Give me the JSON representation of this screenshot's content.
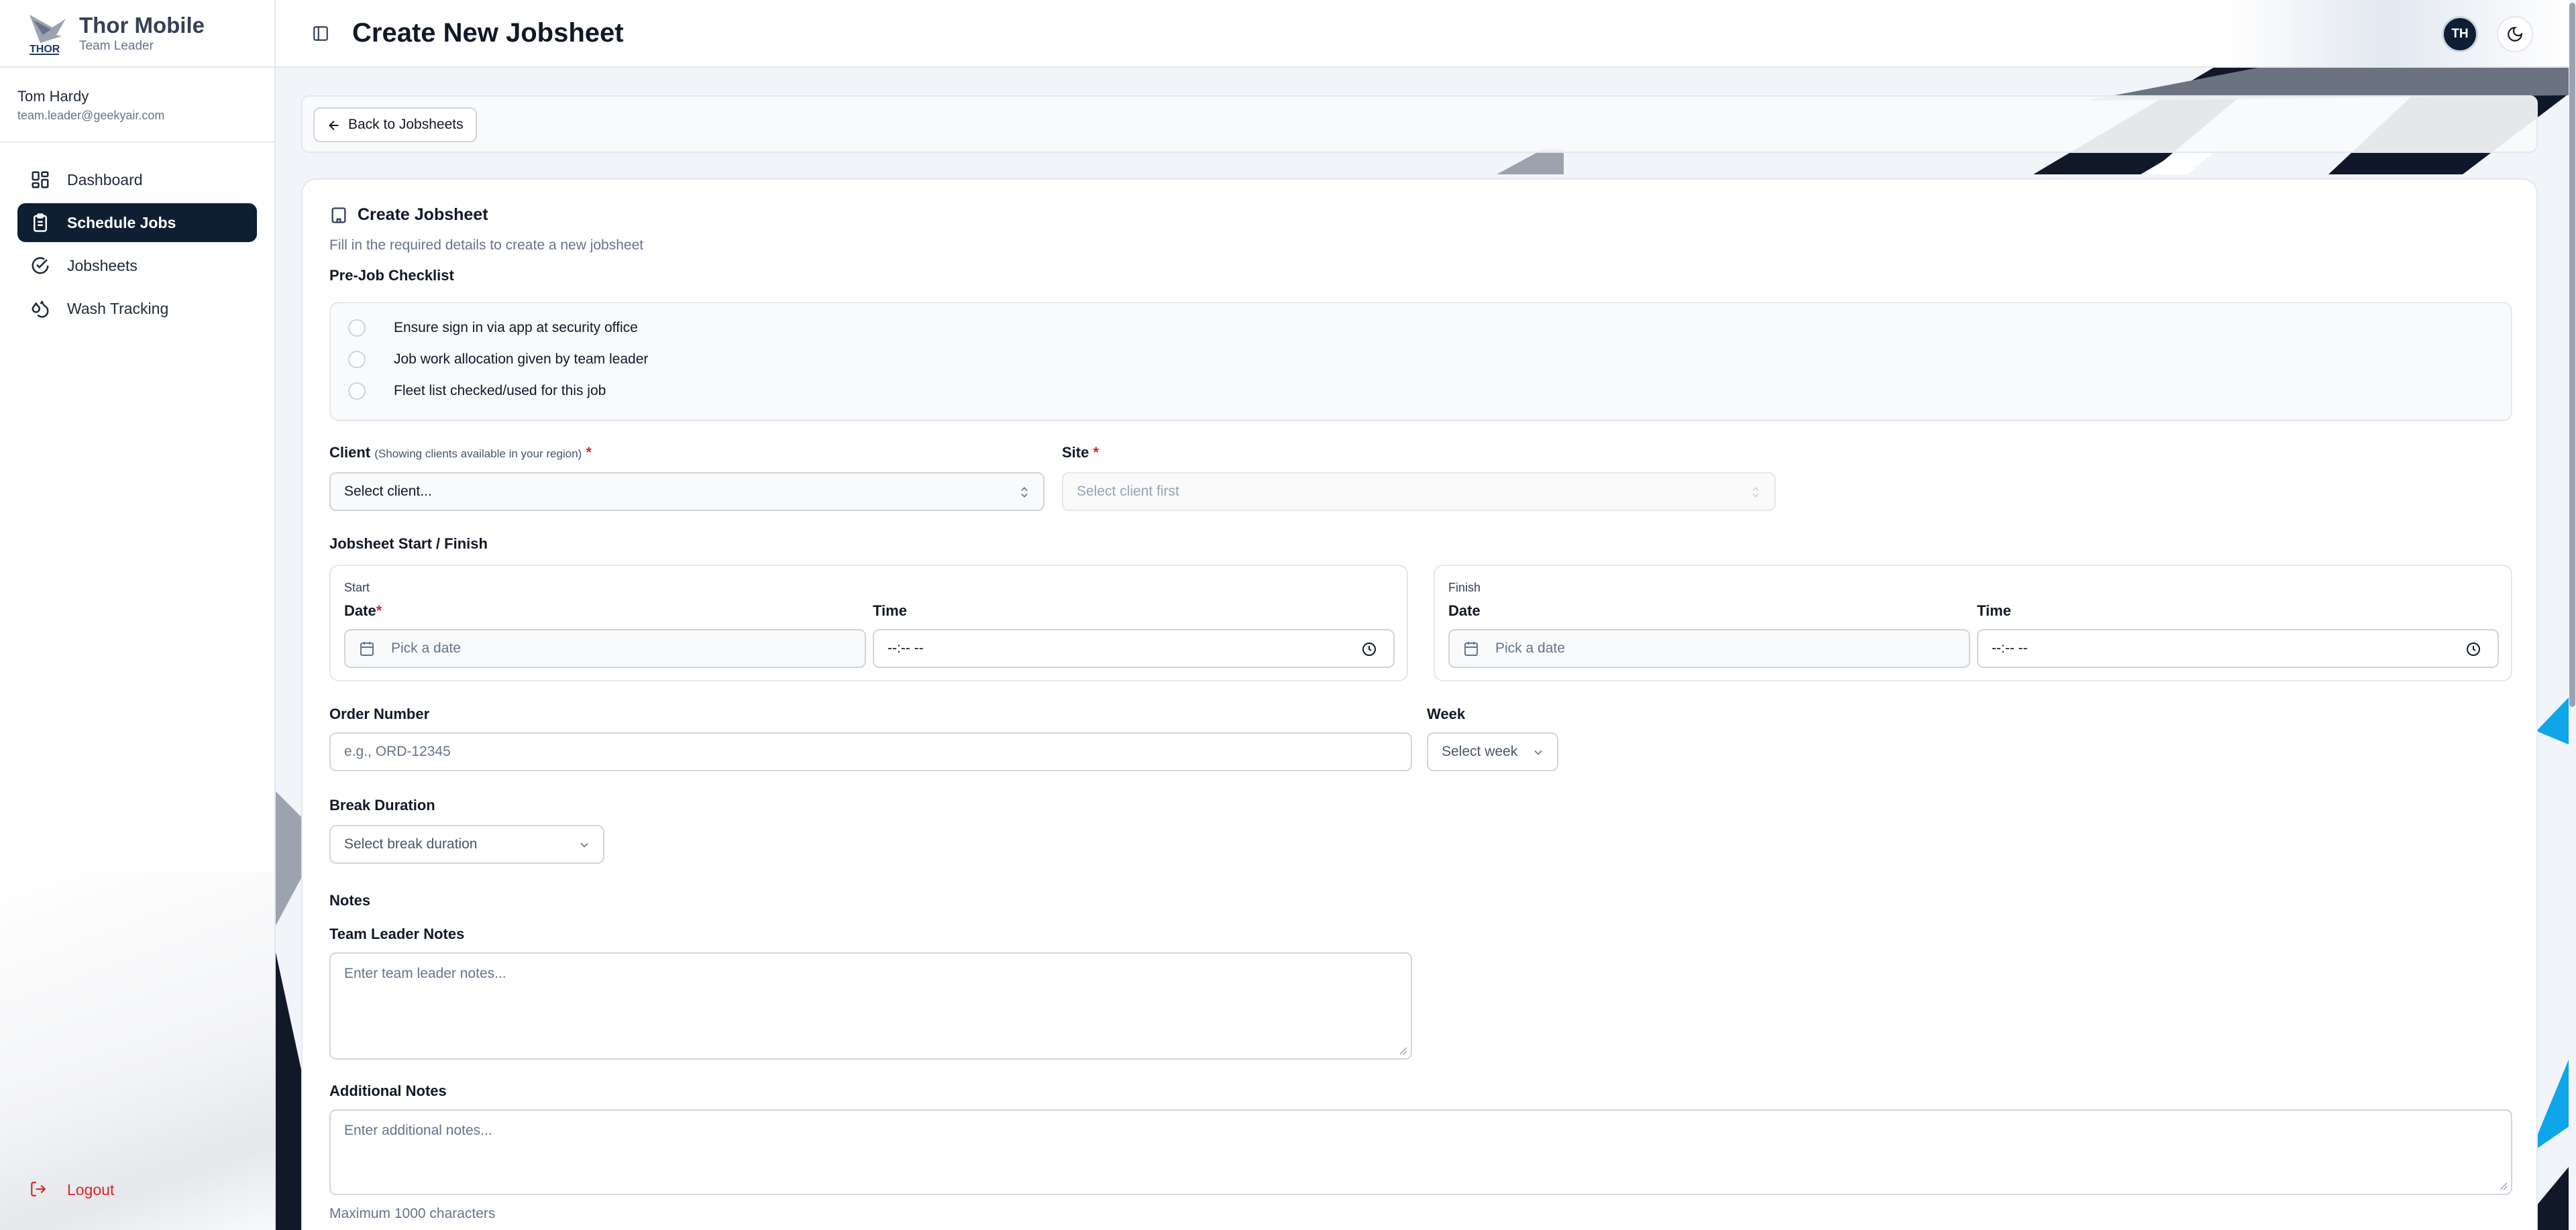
{
  "brand": {
    "name": "Thor Mobile",
    "role": "Team Leader",
    "logo_text": "THOR"
  },
  "user": {
    "name": "Tom Hardy",
    "email": "team.leader@geekyair.com"
  },
  "nav": [
    {
      "label": "Dashboard",
      "icon": "grid-icon",
      "active": false
    },
    {
      "label": "Schedule Jobs",
      "icon": "clipboard-icon",
      "active": true
    },
    {
      "label": "Jobsheets",
      "icon": "check-circle-icon",
      "active": false
    },
    {
      "label": "Wash Tracking",
      "icon": "droplets-icon",
      "active": false
    }
  ],
  "logout_label": "Logout",
  "header": {
    "title": "Create New Jobsheet",
    "avatar_initials": "TH"
  },
  "back_label": "Back to Jobsheets",
  "form": {
    "title": "Create Jobsheet",
    "subtitle": "Fill in the required details to create a new jobsheet",
    "checklist_title": "Pre-Job Checklist",
    "checklist": [
      "Ensure sign in via app at security office",
      "Job work allocation given by team leader",
      "Fleet list checked/used for this job"
    ],
    "client_label": "Client",
    "client_hint": "(Showing clients available in your region)",
    "client_placeholder": "Select client...",
    "site_label": "Site",
    "site_placeholder": "Select client first",
    "schedule_title": "Jobsheet Start / Finish",
    "start": {
      "heading": "Start",
      "date_label": "Date",
      "date_placeholder": "Pick a date",
      "time_label": "Time",
      "time_value": "--:-- --"
    },
    "finish": {
      "heading": "Finish",
      "date_label": "Date",
      "date_placeholder": "Pick a date",
      "time_label": "Time",
      "time_value": "--:-- --"
    },
    "order_label": "Order Number",
    "order_placeholder": "e.g., ORD-12345",
    "week_label": "Week",
    "week_placeholder": "Select week",
    "break_label": "Break Duration",
    "break_placeholder": "Select break duration",
    "notes_title": "Notes",
    "tl_notes_label": "Team Leader Notes",
    "tl_notes_placeholder": "Enter team leader notes...",
    "additional_label": "Additional Notes",
    "additional_placeholder": "Enter additional notes...",
    "max_chars_note": "Maximum 1000 characters",
    "required_mark": "*"
  },
  "colors": {
    "primary": "#0f1f33",
    "danger": "#dc2626",
    "muted_text": "#64748b",
    "border": "#d1d5db",
    "accent_stripe": "#0ea5e9"
  }
}
